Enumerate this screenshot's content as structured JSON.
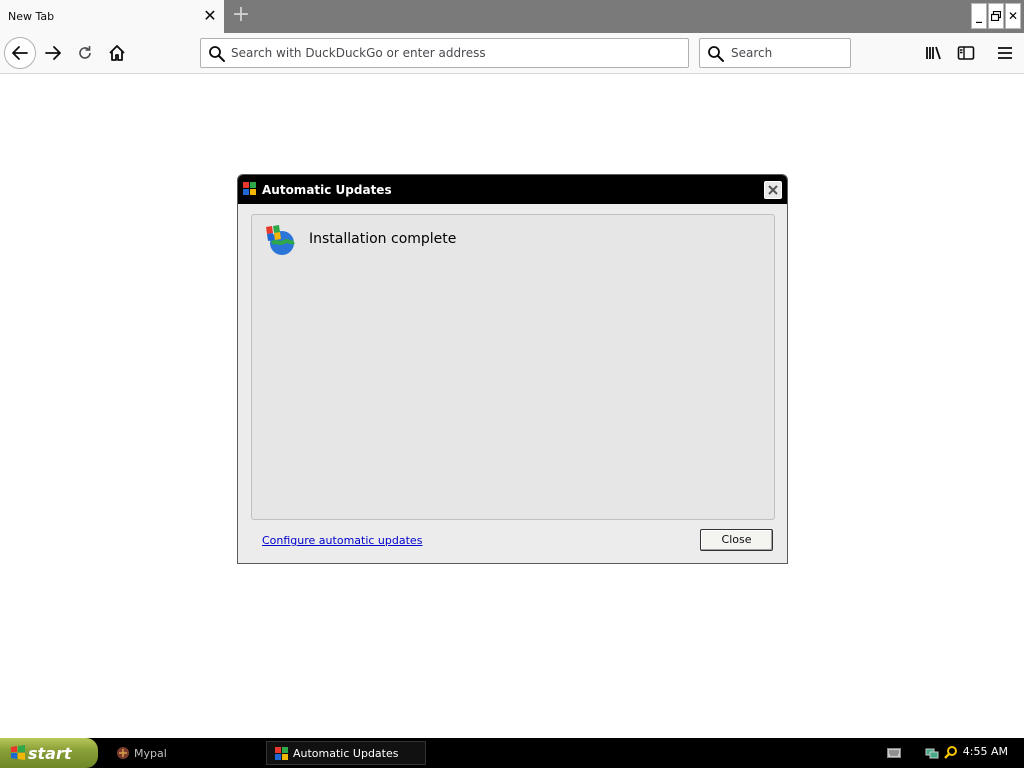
{
  "browser": {
    "tab": {
      "title": "New Tab"
    },
    "urlbar": {
      "placeholder": "Search with DuckDuckGo or enter address",
      "value": ""
    },
    "searchbar": {
      "placeholder": "Search",
      "value": ""
    }
  },
  "dialog": {
    "title": "Automatic Updates",
    "message": "Installation complete",
    "link": "Configure automatic updates",
    "close_button": "Close"
  },
  "taskbar": {
    "start_label": "start",
    "items": [
      {
        "label": "Mypal"
      },
      {
        "label": "Automatic Updates"
      }
    ],
    "clock": "4:55 AM"
  }
}
